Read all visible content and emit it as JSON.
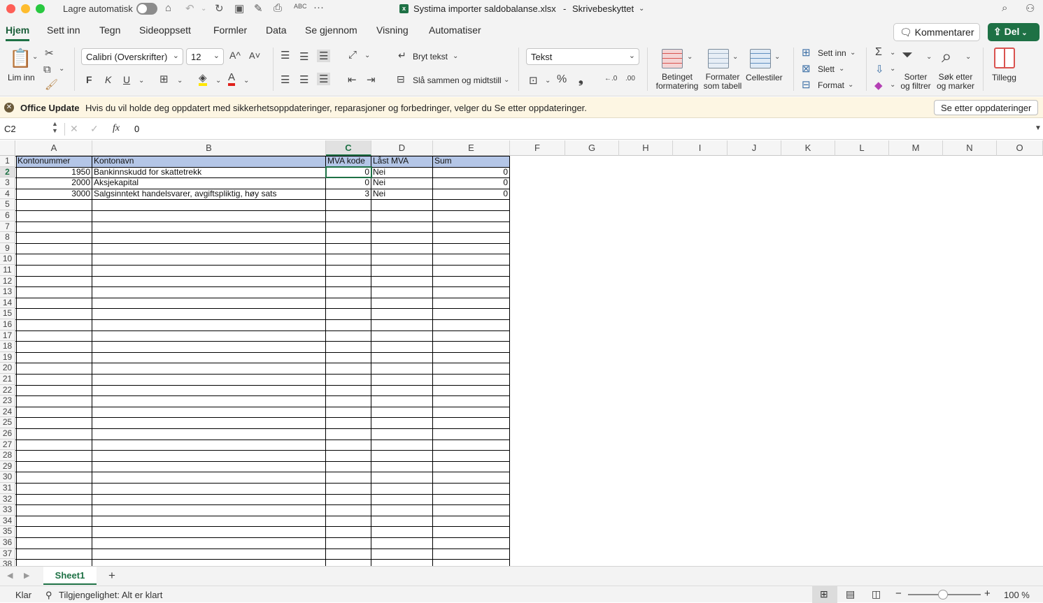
{
  "titlebar": {
    "autosave_label": "Lagre automatisk",
    "doc_title": "Systima importer saldobalanse.xlsx",
    "doc_status": "Skrivebeskyttet",
    "spell_label": "ABC",
    "more_label": "···"
  },
  "tabs": [
    "Hjem",
    "Sett inn",
    "Tegn",
    "Sideoppsett",
    "Formler",
    "Data",
    "Se gjennom",
    "Visning",
    "Automatiser"
  ],
  "tabs_right": {
    "comments": "Kommentarer",
    "share": "Del"
  },
  "ribbon": {
    "paste_label": "Lim inn",
    "font_name": "Calibri (Overskrifter)",
    "font_size": "12",
    "grow_font": "A^",
    "shrink_font": "A˅",
    "bold": "F",
    "italic": "K",
    "underline": "U",
    "wrap_text": "Bryt tekst",
    "merge_center": "Slå sammen og midtstill",
    "number_format": "Tekst",
    "percent": "%",
    "comma": "❟",
    "inc_decimal": "←.0",
    "dec_decimal": ".00",
    "cond_format": [
      "Betinget",
      "formatering"
    ],
    "format_table": [
      "Formater",
      "som tabell"
    ],
    "cell_styles": "Cellestiler",
    "insert_cells": "Sett inn",
    "delete_cells": "Slett",
    "format_cells": "Format",
    "sort_filter": [
      "Sorter",
      "og filtrer"
    ],
    "find_select": [
      "Søk etter",
      "og marker"
    ],
    "addins": "Tillegg"
  },
  "message": {
    "title": "Office Update",
    "text": "Hvis du vil holde deg oppdatert med sikkerhetsoppdateringer, reparasjoner og forbedringer, velger du Se etter oppdateringer.",
    "button": "Se etter oppdateringer"
  },
  "formula_bar": {
    "name_box": "C2",
    "formula": "0"
  },
  "sheet": {
    "columns": [
      "A",
      "B",
      "C",
      "D",
      "E",
      "F",
      "G",
      "H",
      "I",
      "J",
      "K",
      "L",
      "M",
      "N",
      "O"
    ],
    "selected_column": "C",
    "selected_row": 2,
    "row_count": 38,
    "header_row": [
      "Kontonummer",
      "Kontonavn",
      "MVA kode",
      "Låst MVA",
      "Sum"
    ],
    "rows": [
      [
        "1950",
        "Bankinnskudd for skattetrekk",
        "0",
        "Nei",
        "0"
      ],
      [
        "2000",
        "Aksjekapital",
        "0",
        "Nei",
        "0"
      ],
      [
        "3000",
        "Salgsinntekt handelsvarer, avgiftspliktig, høy sats",
        "3",
        "Nei",
        "0"
      ]
    ],
    "header_fill": "#b4c6e7"
  },
  "sheet_tabs": {
    "active": "Sheet1",
    "add": "+"
  },
  "status": {
    "ready": "Klar",
    "accessibility": "Tilgjengelighet: Alt er klart",
    "zoom": "100 %"
  },
  "colors": {
    "accent": "#1e7145",
    "close": "#fe5f57",
    "minimize": "#febc2e",
    "maximize": "#28c840"
  }
}
